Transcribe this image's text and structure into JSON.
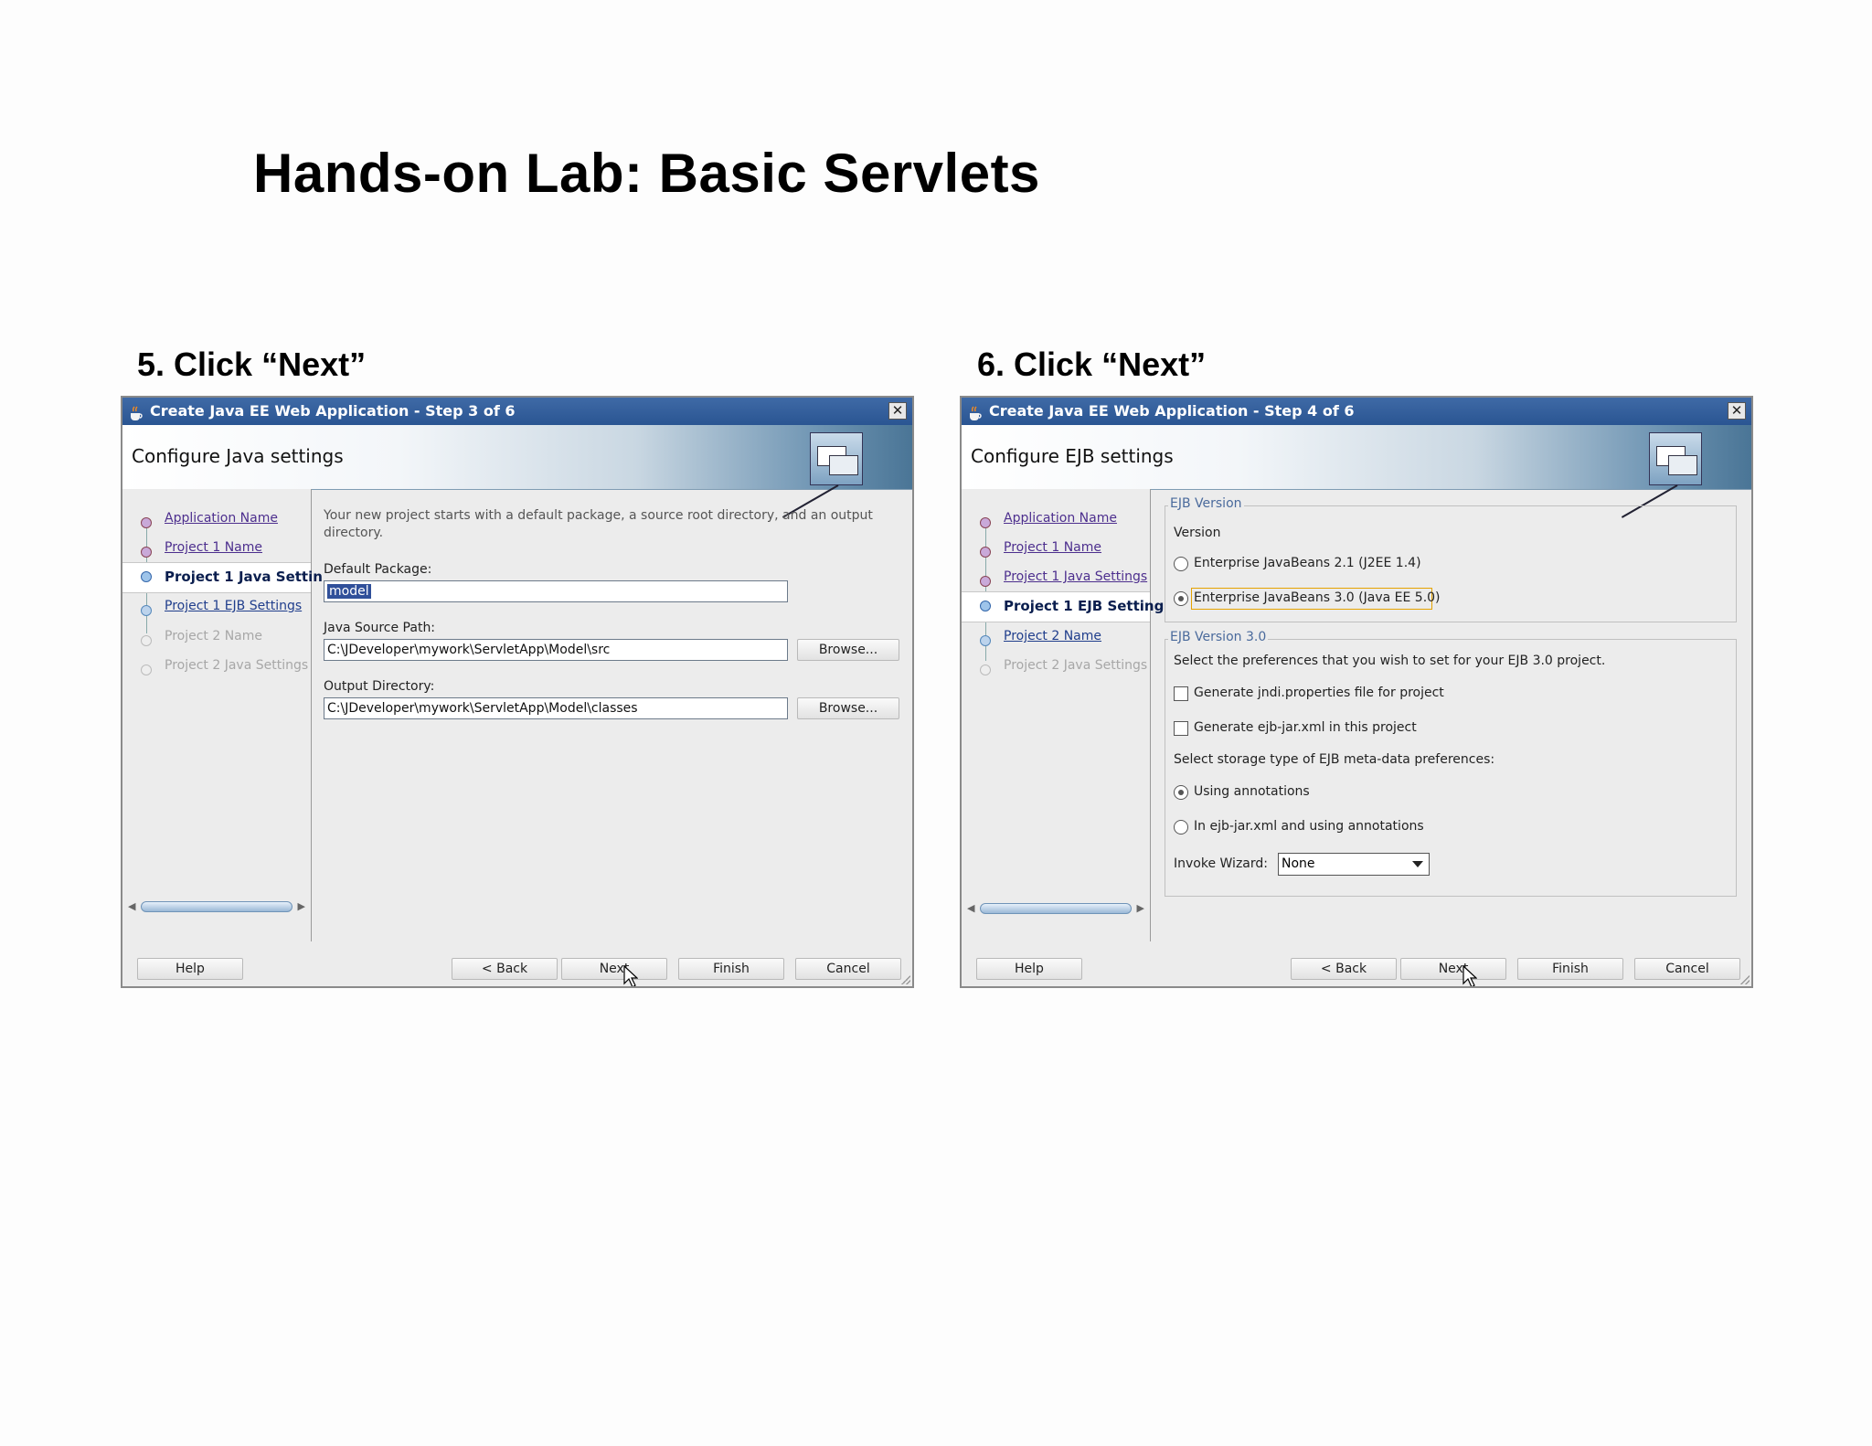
{
  "slide": {
    "title": "Hands-on Lab: Basic Servlets",
    "captions": [
      "5. Click “Next”",
      "6. Click “Next”"
    ]
  },
  "dialogs": [
    {
      "window_title": "Create Java EE Web Application - Step 3 of 6",
      "close": "✕",
      "header": "Configure Java settings",
      "nav": [
        {
          "label": "Application Name",
          "state": "visited"
        },
        {
          "label": "Project 1 Name",
          "state": "visited"
        },
        {
          "label": "Project 1 Java Settin",
          "state": "current"
        },
        {
          "label": "Project 1 EJB Settings",
          "state": "next"
        },
        {
          "label": "Project 2 Name",
          "state": "disabled"
        },
        {
          "label": "Project 2 Java Settings",
          "state": "disabled"
        }
      ],
      "description_line1": "Your new project starts with a default package, a source root directory, and an output",
      "description_line2": "directory.",
      "default_package_label": "Default Package:",
      "default_package_value": "model",
      "java_source_path_label": "Java Source Path:",
      "java_source_path_value": "C:\\JDeveloper\\mywork\\ServletApp\\Model\\src",
      "output_directory_label": "Output Directory:",
      "output_directory_value": "C:\\JDeveloper\\mywork\\ServletApp\\Model\\classes",
      "browse_label": "Browse...",
      "footer": {
        "help": "Help",
        "back": "< Back",
        "next": "Next",
        "finish": "Finish",
        "cancel": "Cancel"
      }
    },
    {
      "window_title": "Create Java EE Web Application - Step 4 of 6",
      "close": "✕",
      "header": "Configure EJB settings",
      "nav": [
        {
          "label": "Application Name",
          "state": "visited"
        },
        {
          "label": "Project 1 Name",
          "state": "visited"
        },
        {
          "label": "Project 1 Java Settings",
          "state": "visited"
        },
        {
          "label": "Project 1 EJB Setting",
          "state": "current"
        },
        {
          "label": "Project 2 Name",
          "state": "next"
        },
        {
          "label": "Project 2 Java Settings",
          "state": "disabled"
        }
      ],
      "ejb_version_group": "EJB Version",
      "version_label": "Version",
      "ejb21_label": "Enterprise JavaBeans 2.1 (J2EE 1.4)",
      "ejb30_label": "Enterprise JavaBeans 3.0 (Java EE 5.0)",
      "ejb30_group": "EJB Version 3.0",
      "preferences_text": "Select the preferences that you wish to set for your EJB 3.0 project.",
      "jndi_label": "Generate jndi.properties file for project",
      "ejbjar_label": "Generate ejb-jar.xml in this project",
      "storage_text": "Select storage type of EJB meta-data preferences:",
      "annotations_label": "Using annotations",
      "ejbjar_annotations_label": "In ejb-jar.xml and using annotations",
      "invoke_wizard_label": "Invoke Wizard:",
      "invoke_wizard_value": "None",
      "footer": {
        "help": "Help",
        "back": "< Back",
        "next": "Next",
        "finish": "Finish",
        "cancel": "Cancel"
      }
    }
  ]
}
